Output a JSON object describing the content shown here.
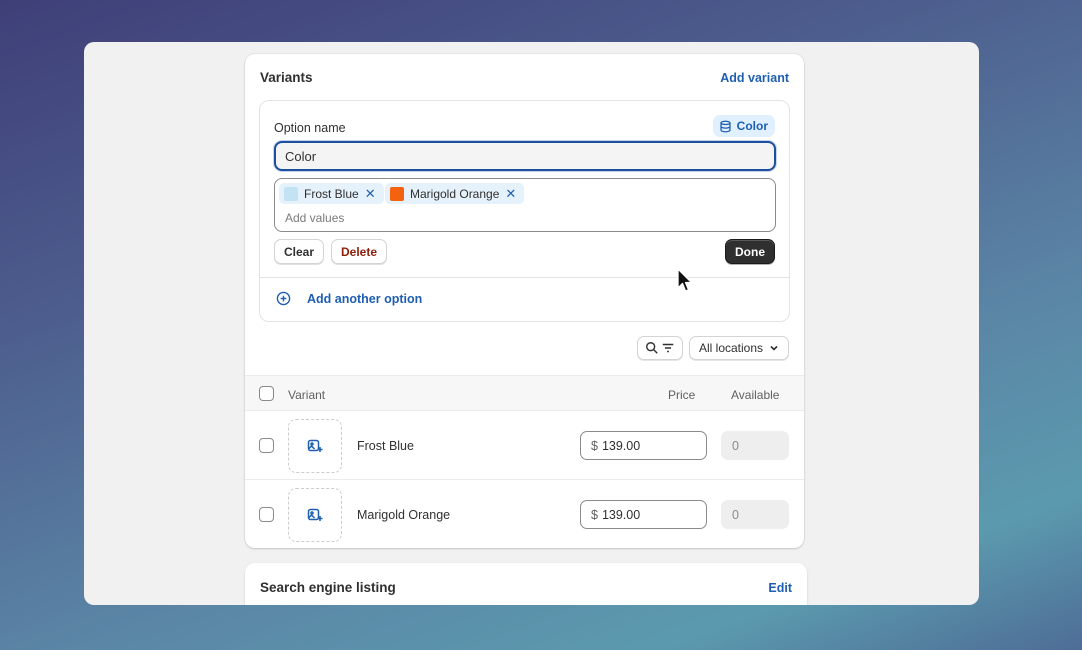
{
  "variants_card": {
    "title": "Variants",
    "add_variant_label": "Add variant"
  },
  "option_editor": {
    "option_name_label": "Option name",
    "metafield_badge": {
      "label": "Color",
      "icon": "database-icon"
    },
    "name_value": "Color",
    "values": [
      {
        "label": "Frost Blue",
        "swatch": "#c3e3f4"
      },
      {
        "label": "Marigold Orange",
        "swatch": "#f4620f"
      }
    ],
    "values_placeholder": "Add values",
    "clear_label": "Clear",
    "delete_label": "Delete",
    "done_label": "Done"
  },
  "add_option_label": "Add another option",
  "filters": {
    "search_filter_icon": "search-filter-icon",
    "locations_label": "All locations"
  },
  "table": {
    "headers": {
      "variant": "Variant",
      "price": "Price",
      "available": "Available"
    },
    "rows": [
      {
        "name": "Frost Blue",
        "currency": "$",
        "price": "139.00",
        "available": "0"
      },
      {
        "name": "Marigold Orange",
        "currency": "$",
        "price": "139.00",
        "available": "0"
      }
    ]
  },
  "seo_card": {
    "title": "Search engine listing",
    "edit_label": "Edit"
  },
  "colors": {
    "accent": "#1f5fb0",
    "primary_button": "#2f2f2f",
    "destructive": "#8e1f0b"
  }
}
